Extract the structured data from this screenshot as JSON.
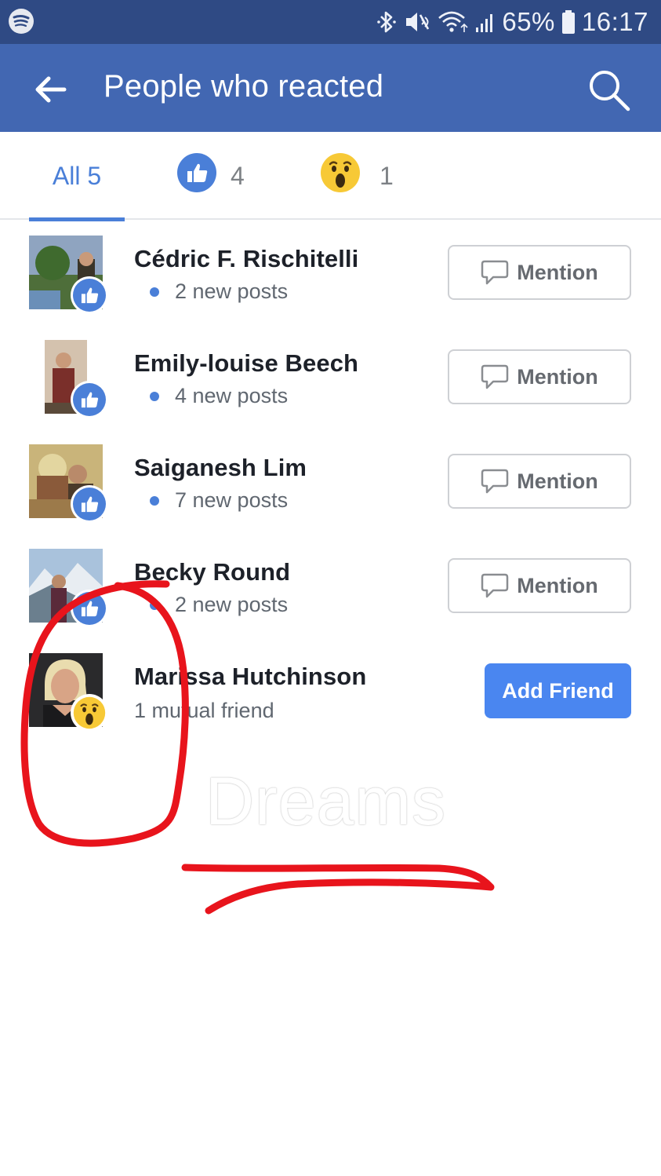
{
  "status_bar": {
    "app_icon": "spotify-icon",
    "battery": "65%",
    "time": "16:17",
    "icons": [
      "bluetooth-icon",
      "mute-vibrate-icon",
      "wifi-icon",
      "signal-icon",
      "battery-icon"
    ]
  },
  "header": {
    "title": "People who reacted",
    "back_icon": "back-arrow-icon",
    "search_icon": "search-icon"
  },
  "tabs": [
    {
      "label": "All 5",
      "active": true
    },
    {
      "icon": "like-reaction-icon",
      "count": "4",
      "active": false
    },
    {
      "icon": "wow-reaction-icon",
      "count": "1",
      "active": false
    }
  ],
  "people": [
    {
      "name": "Cédric F. Rischitelli",
      "subtitle": "2 new posts",
      "reaction": "like",
      "action": "Mention"
    },
    {
      "name": "Emily-louise Beech",
      "subtitle": "4 new posts",
      "reaction": "like",
      "action": "Mention"
    },
    {
      "name": "Saiganesh Lim",
      "subtitle": "7 new posts",
      "reaction": "like",
      "action": "Mention"
    },
    {
      "name": "Becky Round",
      "subtitle": "2 new posts",
      "reaction": "like",
      "action": "Mention"
    },
    {
      "name": "Marissa Hutchinson",
      "subtitle": "1 mutual friend",
      "reaction": "wow",
      "action": "Add Friend"
    }
  ],
  "watermark": "Dreams",
  "colors": {
    "status_bar": "#2f4a84",
    "app_bar": "#4267b2",
    "accent": "#4a7fd8",
    "add_friend": "#4a86f0",
    "annotation": "#e8141c",
    "wow": "#f7c936"
  }
}
